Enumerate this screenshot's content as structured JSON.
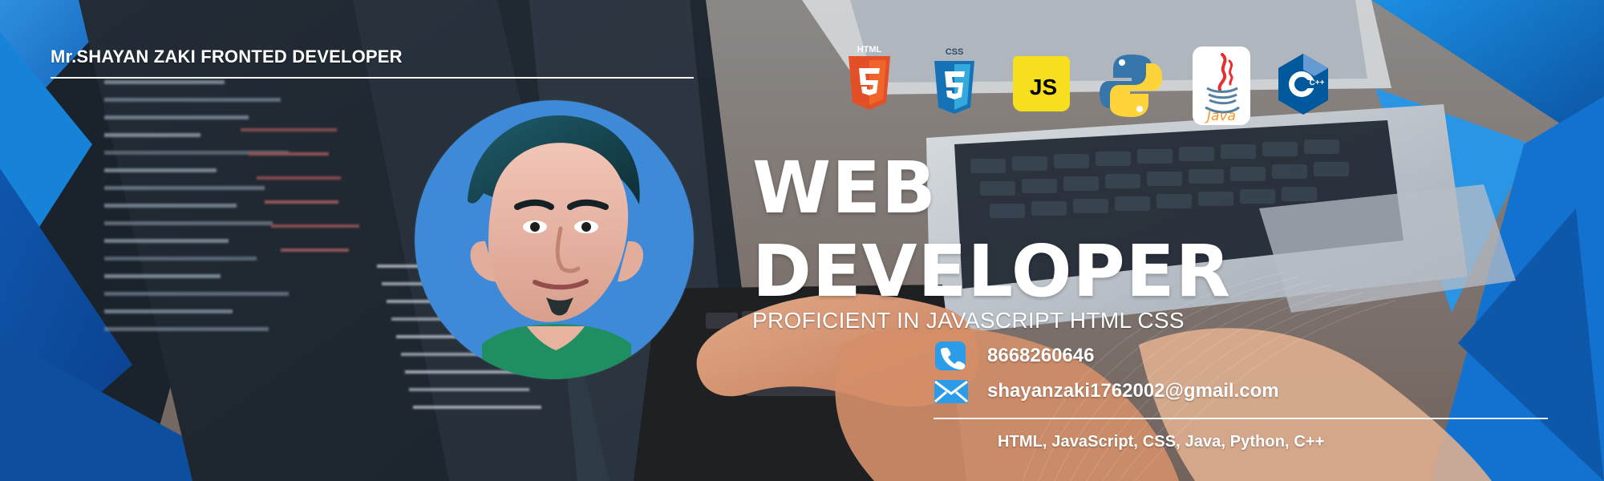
{
  "banner": {
    "brand_line": "Mr.SHAYAN ZAKI FRONTED DEVELOPER",
    "title_line_1": "WEB",
    "title_line_2": "DEVELOPER",
    "subtitle": "PROFICIENT IN JAVASCRIPT HTML CSS",
    "skills": "HTML, JavaScript, CSS, Java, Python, C++"
  },
  "contact": {
    "phone": "8668260646",
    "email": "shayanzaki1762002@gmail.com"
  },
  "icons": {
    "html_label": "HTML",
    "css_label": "CSS",
    "js_label": "JS",
    "java_label": "Java",
    "cpp_label": "C++"
  },
  "colors": {
    "html": "#e34f26",
    "css": "#1572b6",
    "js": "#f7df1e",
    "python_blue": "#3776ab",
    "python_yellow": "#ffd43b",
    "java": "#f89820",
    "cpp": "#00599c",
    "portrait_bg": "#3f8ad8",
    "contact_blue": "#2c9ce8"
  }
}
